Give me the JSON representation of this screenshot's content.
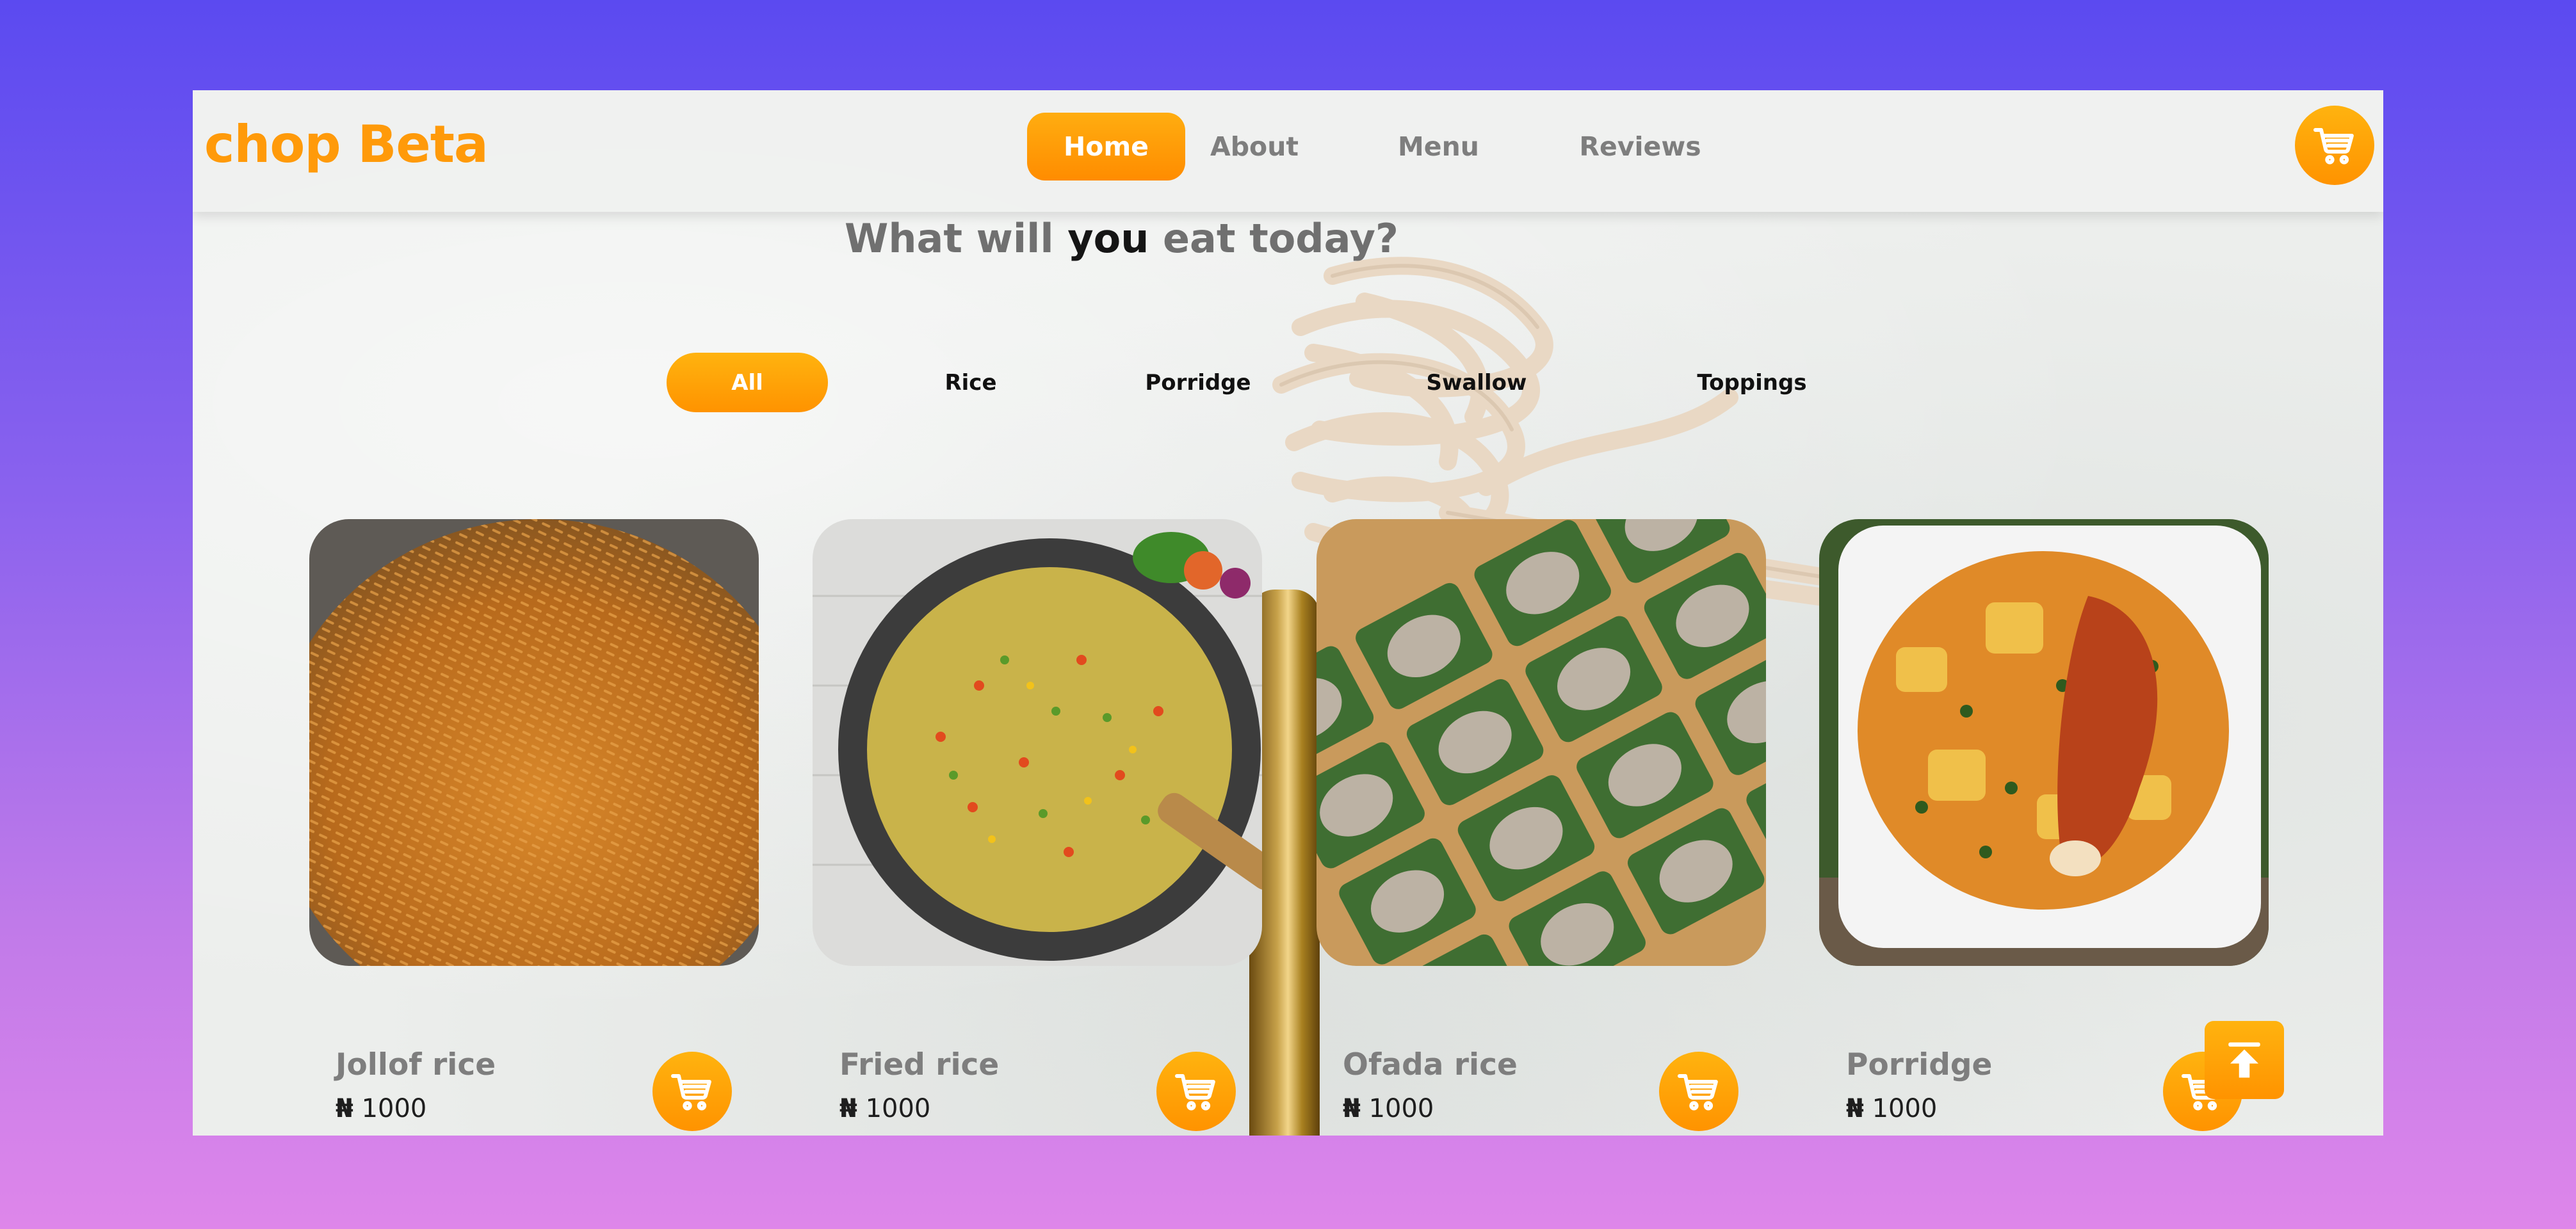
{
  "brand": {
    "logo": "chop Beta"
  },
  "nav": {
    "items": [
      {
        "label": "Home",
        "active": true
      },
      {
        "label": "About",
        "active": false
      },
      {
        "label": "Menu",
        "active": false
      },
      {
        "label": "Reviews",
        "active": false
      }
    ]
  },
  "hero": {
    "headline_before": "What will ",
    "headline_emphasis": "you",
    "headline_after": " eat today?"
  },
  "filters": [
    {
      "label": "All",
      "active": true
    },
    {
      "label": "Rice",
      "active": false
    },
    {
      "label": "Porridge",
      "active": false
    },
    {
      "label": "Swallow",
      "active": false
    },
    {
      "label": "Toppings",
      "active": false
    }
  ],
  "products": [
    {
      "name": "Jollof rice",
      "currency": "₦",
      "price": "1000"
    },
    {
      "name": "Fried rice",
      "currency": "₦",
      "price": "1000"
    },
    {
      "name": "Ofada rice",
      "currency": "₦",
      "price": "1000"
    },
    {
      "name": "Porridge",
      "currency": "₦",
      "price": "1000"
    }
  ],
  "icons": {
    "cart": "shopping-cart-icon",
    "scroll_top": "arrow-up-to-top-icon"
  },
  "colors": {
    "accent": "#ff9a0a",
    "accent_light": "#ffb30f",
    "muted_text": "#7e7e7e",
    "background_gradient_top": "#5b4af0",
    "background_gradient_bottom": "#de86ea"
  }
}
